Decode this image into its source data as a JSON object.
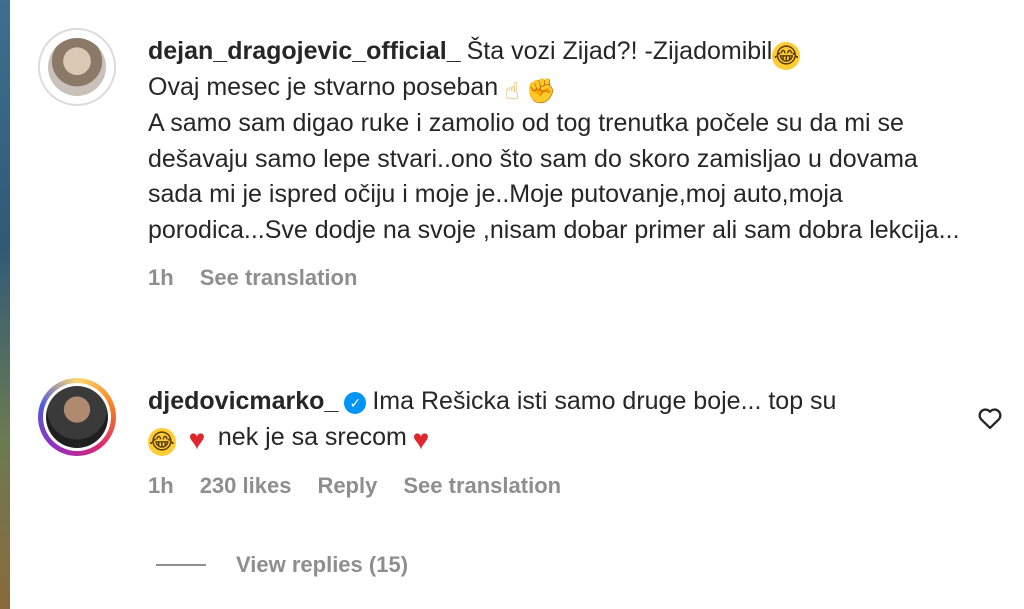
{
  "comments": [
    {
      "username": "dejan_dragojevic_official_",
      "lines": [
        "Šta vozi Zijad?! -Zijadomibil",
        "Ovaj mesec je stvarno poseban",
        "A samo sam digao ruke i zamolio od tog trenutka počele su da mi se dešavaju samo lepe stvari..ono što sam do skoro zamisljao u dovama sada mi je ispred očiju i moje je..Moje putovanje,moj auto,moja porodica...Sve dodje na svoje ,nisam dobar primer ali sam dobra lekcija..."
      ],
      "time": "1h",
      "see_translation": "See translation"
    },
    {
      "username": "djedovicmarko_",
      "verified": true,
      "text_a": "Ima Rešicka isti samo druge boje... top su",
      "text_b": "nek je sa srecom",
      "time": "1h",
      "likes": "230 likes",
      "reply": "Reply",
      "see_translation": "See translation"
    }
  ],
  "view_replies": "View replies (15)",
  "icons": {
    "laugh": "rolling-on-floor-laughing-emoji",
    "heart": "red-heart-emoji",
    "hand": "pointing-hand-emoji",
    "like": "heart-outline-icon",
    "verified": "verified-badge-icon"
  }
}
